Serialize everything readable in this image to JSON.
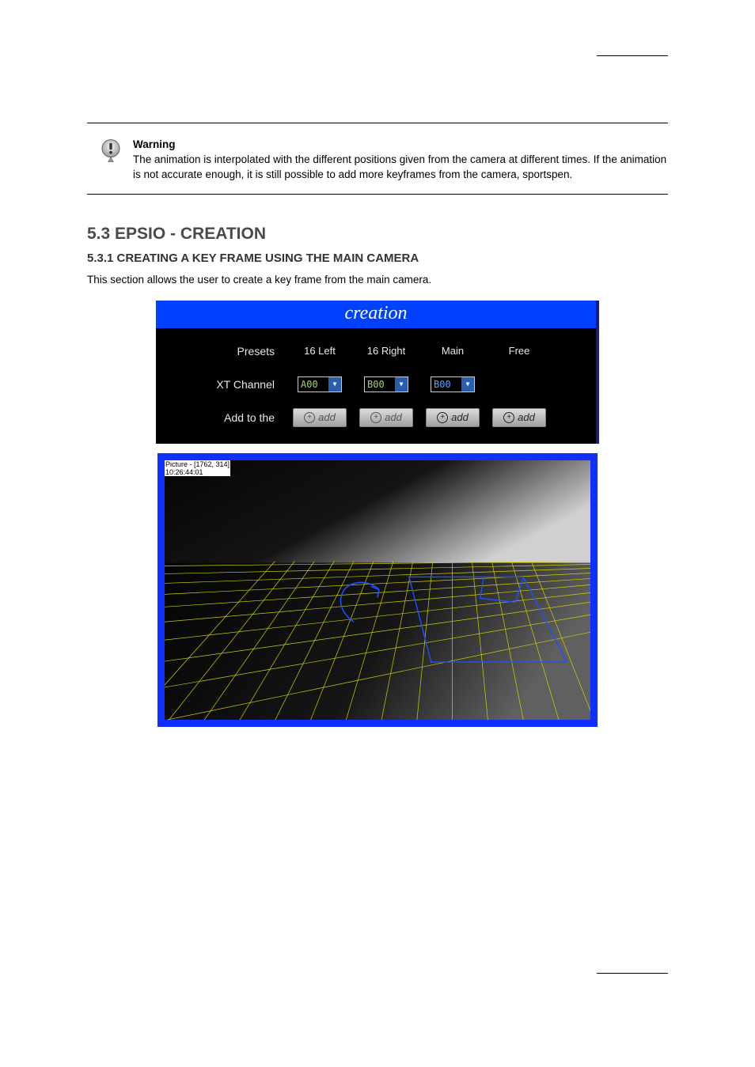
{
  "warning": {
    "title": "Warning",
    "text": "The animation is interpolated with the different positions given from the camera at different times. If the animation is not accurate enough, it is still possible to add more keyframes from the camera, sportspen."
  },
  "heading3": "5.3  EPSIO - CREATION",
  "heading4": "5.3.1  CREATING A KEY FRAME USING THE MAIN CAMERA",
  "para1": "This section allows the user to create a key frame from the main camera.",
  "creation": {
    "header": "creation",
    "rows": {
      "presets": {
        "label": "Presets",
        "cells": [
          "16 Left",
          "16 Right",
          "Main",
          "Free"
        ]
      },
      "xt": {
        "label": "XT Channel",
        "cells": [
          "A00",
          "B00",
          "B00"
        ]
      },
      "add": {
        "label": "Add to the",
        "button": "add"
      }
    }
  },
  "picture": {
    "label_line1": "Picture - [1762, 314]",
    "label_line2": "10:26:44:01"
  },
  "chart_data": {
    "type": "other",
    "note": "Perspective field view with yellow grid overlay and blue arrow/box annotations on gradient background"
  }
}
